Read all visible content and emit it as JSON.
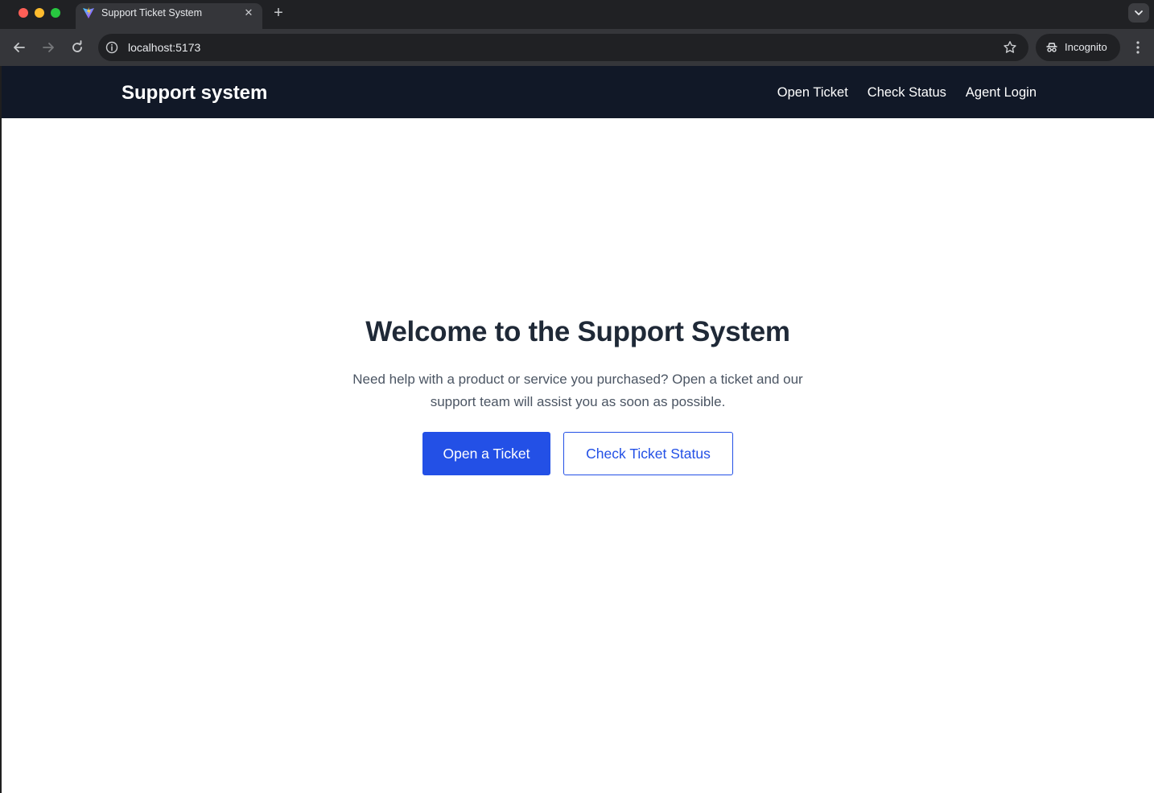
{
  "browser": {
    "tab_title": "Support Ticket System",
    "url": "localhost:5173",
    "incognito_label": "Incognito"
  },
  "navbar": {
    "brand": "Support system",
    "links": [
      {
        "label": "Open Ticket"
      },
      {
        "label": "Check Status"
      },
      {
        "label": "Agent Login"
      }
    ]
  },
  "hero": {
    "title": "Welcome to the Support System",
    "description": "Need help with a product or service you purchased? Open a ticket and our support team will assist you as soon as possible.",
    "primary_button": "Open a Ticket",
    "secondary_button": "Check Ticket Status"
  },
  "colors": {
    "navbar_bg": "#111827",
    "accent": "#2350e6",
    "heading": "#1f2937",
    "body_text": "#4b5563"
  }
}
